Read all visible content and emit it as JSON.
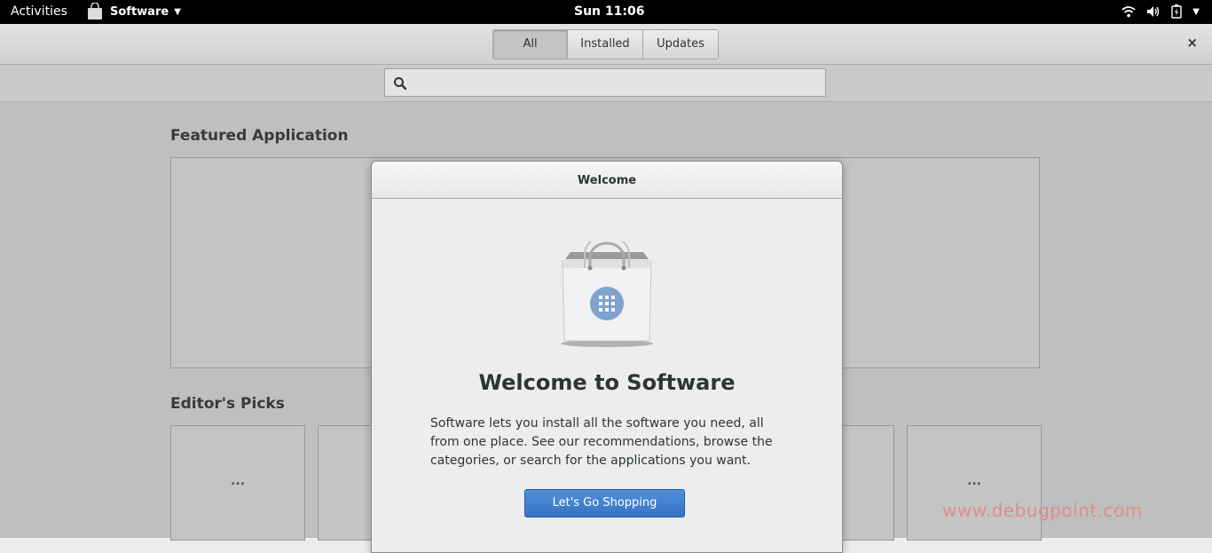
{
  "topbar": {
    "activities": "Activities",
    "app_name": "Software",
    "clock": "Sun 11:06"
  },
  "header": {
    "tabs": [
      "All",
      "Installed",
      "Updates"
    ],
    "active_tab": "All",
    "close": "×"
  },
  "search": {
    "value": "",
    "placeholder": ""
  },
  "content": {
    "featured_title": "Featured Application",
    "editors_title": "Editor's Picks",
    "pick_placeholder": "..."
  },
  "dialog": {
    "title": "Welcome",
    "heading": "Welcome to Software",
    "body": "Software lets you install all the software you need, all from one place. See our recommendations, browse the categories, or search for the applications you want.",
    "button": "Let's Go Shopping"
  },
  "watermark": "www.debugpoint.com",
  "colors": {
    "accent": "#3774c4",
    "topbar": "#000000"
  }
}
